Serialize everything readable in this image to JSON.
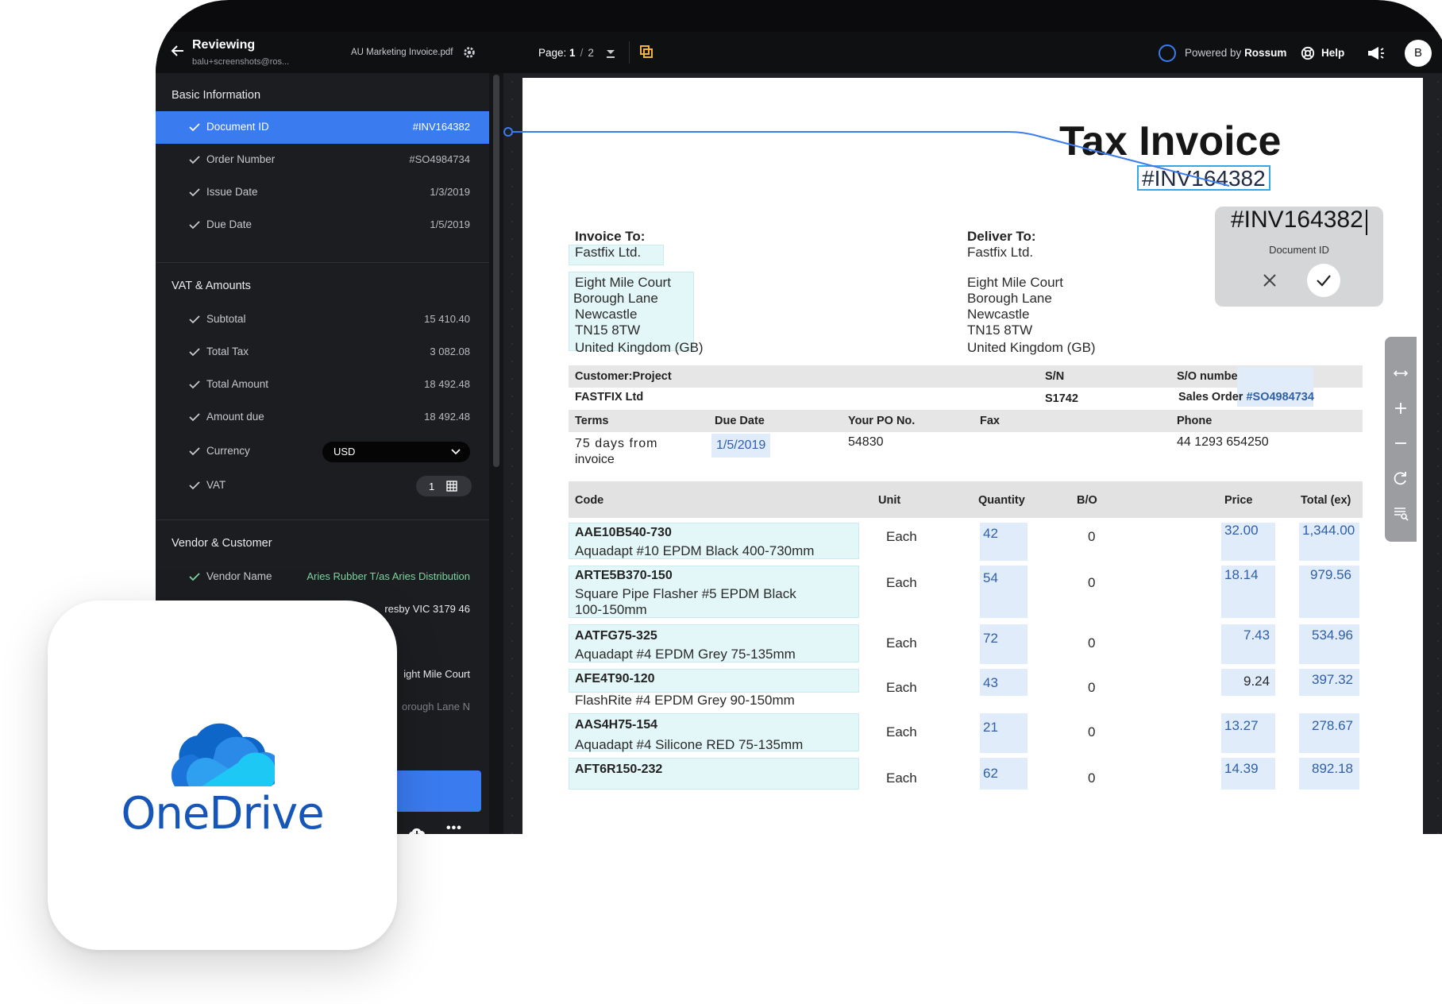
{
  "topbar": {
    "title": "Reviewing",
    "user": "balu+screenshots@ros...",
    "file_name": "AU Marketing Invoice.pdf",
    "page_label": "Page:",
    "page_current": "1",
    "page_sep": "/",
    "page_total": "2",
    "powered_prefix": "Powered by",
    "powered_brand": "Rossum",
    "help": "Help",
    "avatar": "B",
    "accent": "#3a7bf0"
  },
  "sidebar": {
    "sections": {
      "basic": "Basic Information",
      "vat": "VAT & Amounts",
      "vendor": "Vendor & Customer"
    },
    "basic": [
      {
        "label": "Document ID",
        "value": "#INV164382"
      },
      {
        "label": "Order Number",
        "value": "#SO4984734"
      },
      {
        "label": "Issue Date",
        "value": "1/3/2019"
      },
      {
        "label": "Due Date",
        "value": "1/5/2019"
      }
    ],
    "vat": [
      {
        "label": "Subtotal",
        "value": "15 410.40"
      },
      {
        "label": "Total Tax",
        "value": "3 082.08"
      },
      {
        "label": "Total Amount",
        "value": "18 492.48"
      },
      {
        "label": "Amount due",
        "value": "18 492.48"
      },
      {
        "label": "Currency",
        "value": "USD"
      },
      {
        "label": "VAT",
        "value": "1"
      }
    ],
    "vendor": [
      {
        "label": "Vendor Name",
        "value": "Aries Rubber T/as Aries Distribution"
      }
    ],
    "partial_rows": [
      "resby VIC 3179 46",
      "ight Mile Court",
      "orough Lane N"
    ]
  },
  "document": {
    "title": "Tax Invoice",
    "invoice_id": "#INV164382",
    "invoice_to_label": "Invoice To:",
    "deliver_to_label": "Deliver To:",
    "invoice_to": [
      "Fastfix Ltd.",
      "Eight Mile Court",
      "Borough Lane",
      "Newcastle",
      "TN15 8TW",
      "United Kingdom (GB)"
    ],
    "deliver_to": [
      "Fastfix Ltd.",
      "Eight Mile Court",
      "Borough Lane",
      "Newcastle",
      "TN15 8TW",
      "United Kingdom (GB)"
    ],
    "band1": {
      "customer_project": "Customer:Project",
      "sn": "S/N",
      "so_number": "S/O number"
    },
    "row1": {
      "customer": "FASTFIX Ltd",
      "sn": "S1742",
      "sales_order_prefix": "Sales Order",
      "sales_order": "#SO4984734"
    },
    "band2": {
      "terms": "Terms",
      "due_date": "Due Date",
      "po": "Your PO No.",
      "fax": "Fax",
      "phone": "Phone"
    },
    "row2": {
      "terms_line1": "75   days   from",
      "terms_line2": "invoice",
      "due_date": "1/5/2019",
      "po": "54830",
      "phone": "44 1293 654250"
    },
    "table_headers": [
      "Code",
      "Unit",
      "Quantity",
      "B/O",
      "Price",
      "Total (ex)"
    ],
    "items": [
      {
        "code": "AAE10B540-730",
        "desc": "Aquadapt #10 EPDM Black 400-730mm",
        "desc2": "",
        "unit": "Each",
        "qty": "42",
        "bo": "0",
        "price": "32.00",
        "total": "1,344.00"
      },
      {
        "code": "ARTE5B370-150",
        "desc": "Square  Pipe  Flasher  #5  EPDM  Black",
        "desc2": "100-150mm",
        "unit": "Each",
        "qty": "54",
        "bo": "0",
        "price": "18.14",
        "total": "979.56"
      },
      {
        "code": "AATFG75-325",
        "desc": "Aquadapt #4 EPDM Grey 75-135mm",
        "desc2": "",
        "unit": "Each",
        "qty": "72",
        "bo": "0",
        "price": "7.43",
        "total": "534.96"
      },
      {
        "code": "AFE4T90-120",
        "desc": "FlashRite #4 EPDM Grey 90-150mm",
        "desc2": "",
        "unit": "Each",
        "qty": "43",
        "bo": "0",
        "price": "9.24",
        "total": "397.32"
      },
      {
        "code": "AAS4H75-154",
        "desc": "Aquadapt #4 Silicone RED 75-135mm",
        "desc2": "",
        "unit": "Each",
        "qty": "21",
        "bo": "0",
        "price": "13.27",
        "total": "278.67"
      },
      {
        "code": "AFT6R150-232",
        "desc": "",
        "desc2": "",
        "unit": "Each",
        "qty": "62",
        "bo": "0",
        "price": "14.39",
        "total": "892.18"
      }
    ]
  },
  "popup": {
    "value": "#INV164382",
    "label": "Document ID"
  },
  "tools": [
    "expand-horizontal-icon",
    "zoom-in-icon",
    "zoom-out-icon",
    "rotate-icon",
    "search-text-icon"
  ],
  "onedrive": {
    "name": "OneDrive",
    "brand_color": "#1556b8"
  }
}
